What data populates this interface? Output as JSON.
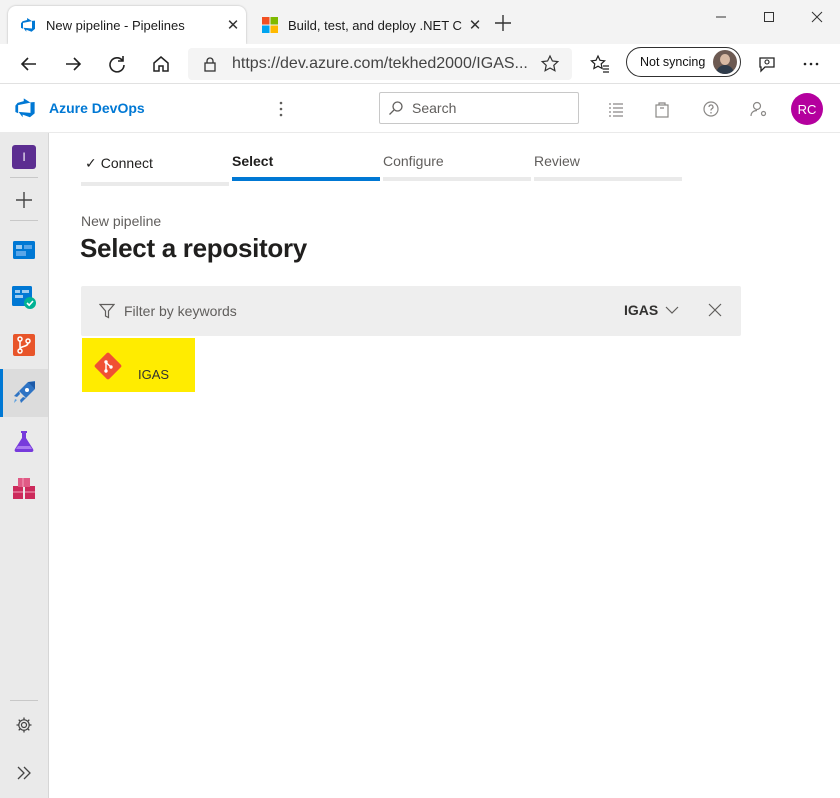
{
  "browser": {
    "tabs": [
      {
        "title": "New pipeline - Pipelines",
        "active": true
      },
      {
        "title": "Build, test, and deploy .NET Core",
        "active": false
      }
    ],
    "address": "https://dev.azure.com/tekhed2000/IGAS...",
    "sync_label": "Not syncing"
  },
  "header": {
    "brand": "Azure DevOps",
    "search_placeholder": "Search",
    "avatar_initials": "RC",
    "avatar_color": "#b4009e"
  },
  "rail": {
    "org_initial": "I",
    "org_color": "#5c2e91",
    "items": [
      "plus-icon",
      "boards-icon",
      "test-plans-check-icon",
      "repos-icon",
      "pipelines-icon",
      "test-plans-icon",
      "artifacts-icon"
    ],
    "bottom": [
      "settings-icon",
      "expand-icon"
    ]
  },
  "wizard": {
    "steps": [
      {
        "label": "Connect",
        "state": "done"
      },
      {
        "label": "Select",
        "state": "active"
      },
      {
        "label": "Configure",
        "state": "pending"
      },
      {
        "label": "Review",
        "state": "pending"
      }
    ]
  },
  "page": {
    "breadcrumb": "New pipeline",
    "title": "Select a repository",
    "filter_placeholder": "Filter by keywords",
    "repo_filter": "IGAS"
  },
  "repos": [
    {
      "name": "IGAS",
      "highlight_color": "#ffec00"
    }
  ],
  "colors": {
    "accent": "#0078d4",
    "git": "#f05133"
  }
}
